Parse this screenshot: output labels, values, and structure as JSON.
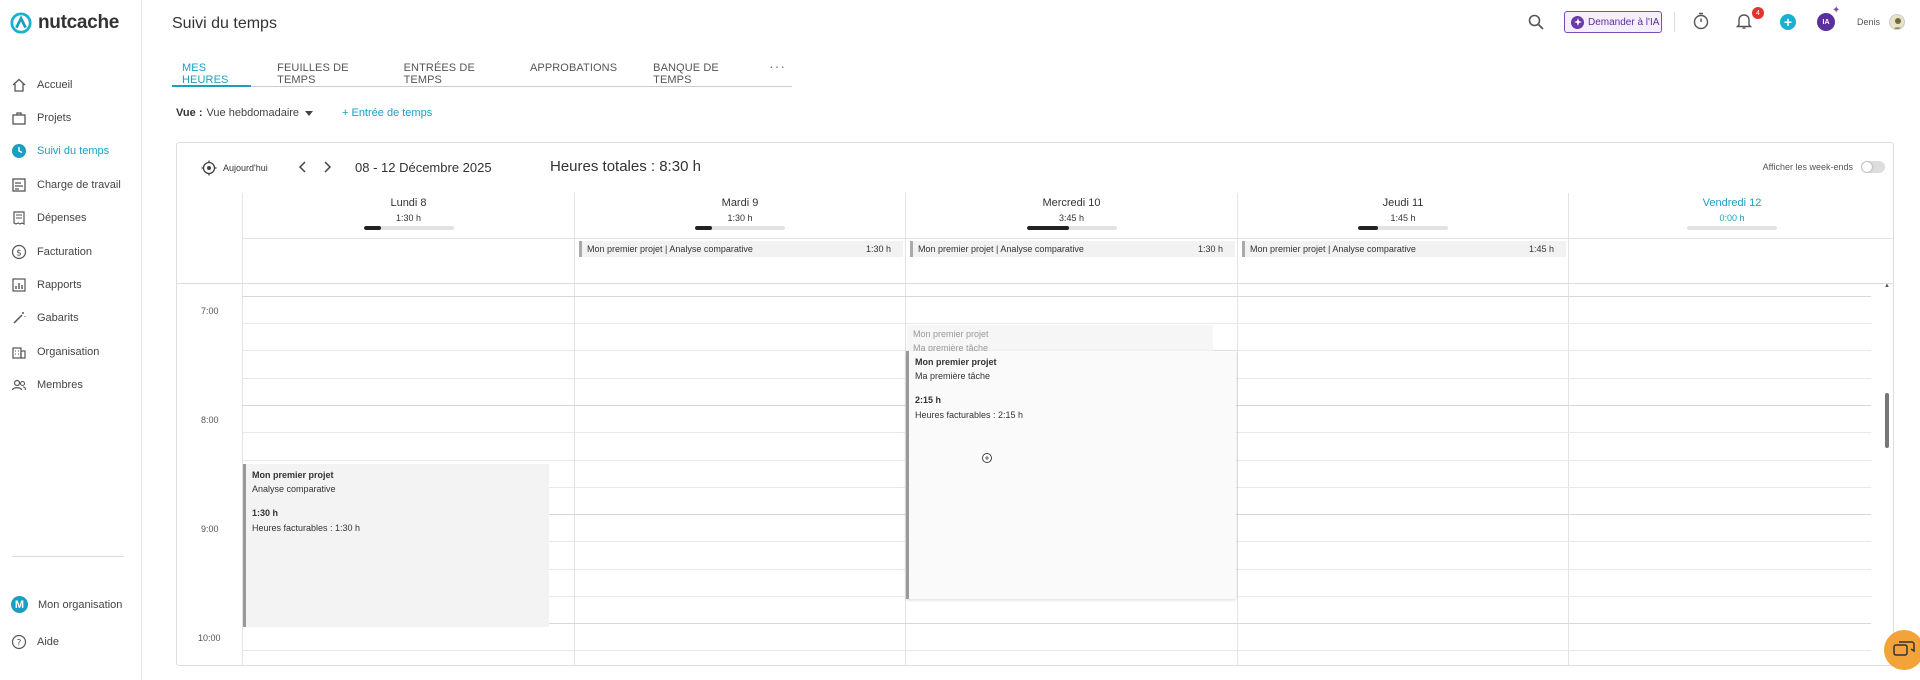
{
  "app": {
    "name": "nutcache"
  },
  "sidebar": {
    "items": [
      {
        "label": "Accueil",
        "icon": "home-icon"
      },
      {
        "label": "Projets",
        "icon": "briefcase-icon"
      },
      {
        "label": "Suivi du temps",
        "icon": "clock-icon",
        "active": true
      },
      {
        "label": "Charge de travail",
        "icon": "workload-icon"
      },
      {
        "label": "Dépenses",
        "icon": "receipt-icon"
      },
      {
        "label": "Facturation",
        "icon": "dollar-icon"
      },
      {
        "label": "Rapports",
        "icon": "chart-icon"
      },
      {
        "label": "Gabarits",
        "icon": "wand-icon"
      },
      {
        "label": "Organisation",
        "icon": "building-icon"
      },
      {
        "label": "Membres",
        "icon": "users-icon"
      }
    ],
    "bottom": [
      {
        "label": "Mon organisation",
        "badge": "M"
      },
      {
        "label": "Aide",
        "icon": "help-icon"
      }
    ]
  },
  "header": {
    "title": "Suivi du temps",
    "ai_button": "Demander à l'IA",
    "notifications_count": "4",
    "ia_badge": "IA",
    "user_name": "Denis"
  },
  "tabs": [
    {
      "label": "MES HEURES",
      "active": true
    },
    {
      "label": "FEUILLES DE TEMPS"
    },
    {
      "label": "ENTRÉES DE TEMPS"
    },
    {
      "label": "APPROBATIONS"
    },
    {
      "label": "BANQUE DE TEMPS"
    }
  ],
  "tabs_more": "···",
  "view": {
    "label": "Vue :",
    "value": "Vue hebdomadaire"
  },
  "add_entry": "+ Entrée de temps",
  "calendar": {
    "today_label": "Aujourd'hui",
    "date_range": "08 - 12 Décembre 2025",
    "total_hours": "Heures totales : 8:30 h",
    "weekend_label": "Afficher les week-ends",
    "days": [
      {
        "name": "Lundi 8",
        "hours": "1:30 h",
        "fill": 0.19,
        "today": false
      },
      {
        "name": "Mardi 9",
        "hours": "1:30 h",
        "fill": 0.19,
        "today": false
      },
      {
        "name": "Mercredi 10",
        "hours": "3:45 h",
        "fill": 0.47,
        "today": false
      },
      {
        "name": "Jeudi 11",
        "hours": "1:45 h",
        "fill": 0.22,
        "today": false
      },
      {
        "name": "Vendredi 12",
        "hours": "0:00 h",
        "fill": 0,
        "today": true
      }
    ],
    "allday": [
      null,
      {
        "title": "Mon premier projet | Analyse comparative",
        "hours": "1:30 h"
      },
      {
        "title": "Mon premier projet | Analyse comparative",
        "hours": "1:30 h"
      },
      {
        "title": "Mon premier projet | Analyse comparative",
        "hours": "1:45 h"
      },
      null
    ],
    "times": [
      "7:00",
      "8:00",
      "9:00",
      "10:00"
    ],
    "events": [
      {
        "project": "Mon premier projet",
        "task": "Analyse comparative",
        "duration": "1:30 h",
        "billable": "Heures facturables : 1:30 h"
      },
      {
        "project": "Mon premier projet",
        "task": "Ma première tâche",
        "duration": "2:15 h",
        "billable": "Heures facturables : 2:15 h"
      }
    ],
    "ghost": {
      "project": "Mon premier projet",
      "task": "Ma première tâche"
    }
  },
  "colors": {
    "accent": "#1a9fc1",
    "ai": "#7b4bb8",
    "badge": "#e5322d"
  }
}
